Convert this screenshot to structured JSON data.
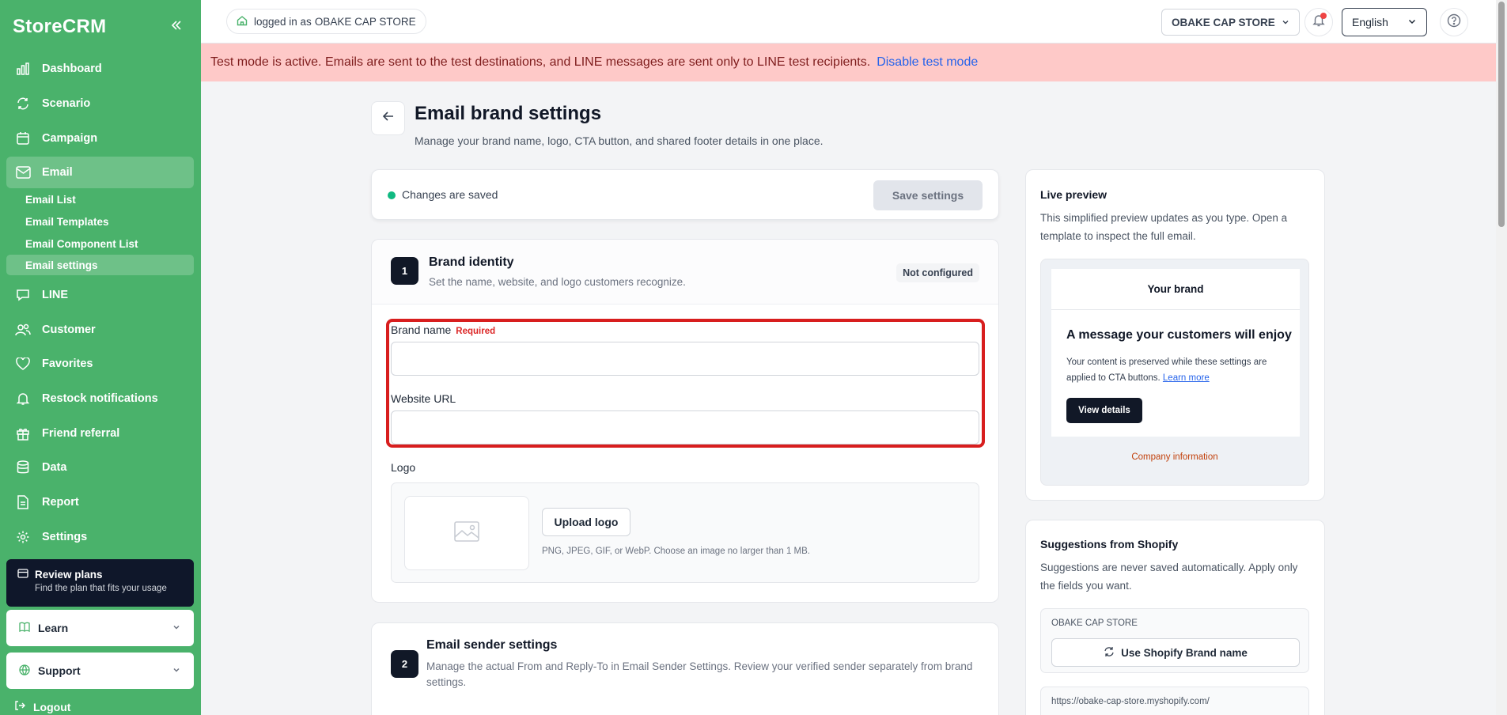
{
  "app": {
    "name": "StoreCRM"
  },
  "sidebar": {
    "items": [
      {
        "label": "Dashboard",
        "icon": "bar-chart-icon"
      },
      {
        "label": "Scenario",
        "icon": "refresh-icon"
      },
      {
        "label": "Campaign",
        "icon": "calendar-icon"
      },
      {
        "label": "Email",
        "icon": "mail-icon"
      },
      {
        "label": "LINE",
        "icon": "chat-icon"
      },
      {
        "label": "Customer",
        "icon": "users-icon"
      },
      {
        "label": "Favorites",
        "icon": "heart-icon"
      },
      {
        "label": "Restock notifications",
        "icon": "bell-icon"
      },
      {
        "label": "Friend referral",
        "icon": "gift-icon"
      },
      {
        "label": "Data",
        "icon": "database-icon"
      },
      {
        "label": "Report",
        "icon": "document-icon"
      },
      {
        "label": "Settings",
        "icon": "gear-icon"
      }
    ],
    "email_sub": [
      "Email List",
      "Email Templates",
      "Email Component List",
      "Email settings"
    ],
    "review": {
      "title": "Review plans",
      "subtitle": "Find the plan that fits your usage"
    },
    "learn": "Learn",
    "support": "Support",
    "logout": "Logout"
  },
  "topbar": {
    "logged_in_prefix": "logged in as",
    "logged_in_store": "OBAKE CAP STORE",
    "store_select": "OBAKE CAP STORE",
    "language": "English"
  },
  "banner": {
    "text": "Test mode is active. Emails are sent to the test destinations, and LINE messages are sent only to LINE test recipients.",
    "link": "Disable test mode"
  },
  "page": {
    "title": "Email brand settings",
    "subtitle": "Manage your brand name, logo, CTA button, and shared footer details in one place."
  },
  "status": {
    "text": "Changes are saved",
    "save_label": "Save settings"
  },
  "brand_identity": {
    "number": "1",
    "title": "Brand identity",
    "subtitle": "Set the name, website, and logo customers recognize.",
    "badge": "Not configured",
    "brand_name_label": "Brand name",
    "required": "Required",
    "brand_name_value": "",
    "website_label": "Website URL",
    "website_value": "",
    "logo_label": "Logo",
    "upload_label": "Upload logo",
    "upload_hint": "PNG, JPEG, GIF, or WebP. Choose an image no larger than 1 MB."
  },
  "sender": {
    "number": "2",
    "title": "Email sender settings",
    "subtitle": "Manage the actual From and Reply-To in Email Sender Settings. Review your verified sender separately from brand settings."
  },
  "preview": {
    "title": "Live preview",
    "text": "This simplified preview updates as you type. Open a template to inspect the full email.",
    "brand": "Your brand",
    "heading": "A message your customers will enjoy",
    "body": "Your content is preserved while these settings are applied to CTA buttons.",
    "learn_more": "Learn more",
    "button": "View details",
    "footer": "Company information"
  },
  "suggestions": {
    "title": "Suggestions from Shopify",
    "text": "Suggestions are never saved automatically. Apply only the fields you want.",
    "store": "OBAKE CAP STORE",
    "use_brand_btn": "Use Shopify Brand name",
    "url": "https://obake-cap-store.myshopify.com/"
  },
  "colors": {
    "sidebar": "#4ab26b",
    "banner": "#fec9c8",
    "highlight": "#d81e1e",
    "accent": "#111827"
  }
}
